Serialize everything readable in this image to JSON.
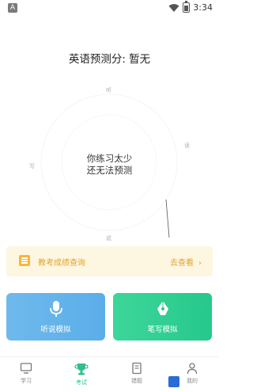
{
  "status_bar": {
    "notification_glyph": "A",
    "time": "3:34"
  },
  "header": {
    "score_label": "英语预测分: 暂无"
  },
  "radar": {
    "axis_labels": {
      "top": "听",
      "left": "写",
      "right": "读",
      "bottom": "说"
    },
    "message_line1": "你练习太少",
    "message_line2": "还无法预测"
  },
  "banner": {
    "text": "教考成绩查询",
    "link_label": "去查看",
    "chevron": "›",
    "accent": "#e0a42a"
  },
  "cards": [
    {
      "label": "听说模拟",
      "icon": "microphone-icon",
      "color": "#5aaee9"
    },
    {
      "label": "笔写模拟",
      "icon": "pen-icon",
      "color": "#26c88b"
    }
  ],
  "tabbar": {
    "items": [
      {
        "label": "学习",
        "icon": "monitor-icon"
      },
      {
        "label": "考试",
        "icon": "trophy-icon",
        "active": true
      },
      {
        "label": "错题",
        "icon": "notebook-icon"
      },
      {
        "label": "我的",
        "icon": "person-icon"
      }
    ],
    "active_color": "#2ec08a"
  }
}
